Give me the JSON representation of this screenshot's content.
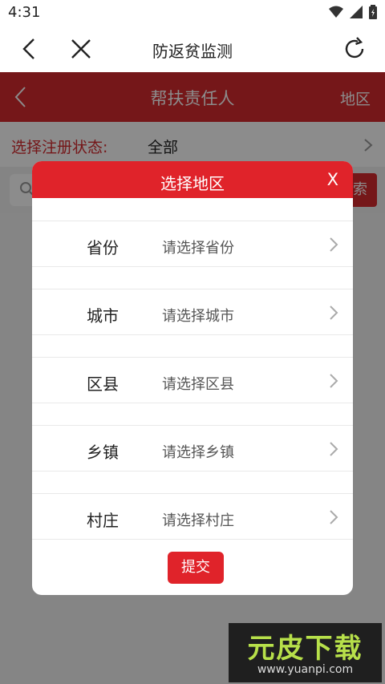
{
  "status_bar": {
    "time": "4:31"
  },
  "nav": {
    "title": "防返贫监测"
  },
  "app_bar": {
    "title": "帮扶责任人",
    "region_label": "地区"
  },
  "filter": {
    "label": "选择注册状态:",
    "value": "全部"
  },
  "search": {
    "button_label": "索"
  },
  "modal": {
    "title": "选择地区",
    "close_label": "X",
    "rows": [
      {
        "label": "省份",
        "placeholder": "请选择省份"
      },
      {
        "label": "城市",
        "placeholder": "请选择城市"
      },
      {
        "label": "区县",
        "placeholder": "请选择区县"
      },
      {
        "label": "乡镇",
        "placeholder": "请选择乡镇"
      },
      {
        "label": "村庄",
        "placeholder": "请选择村庄"
      }
    ],
    "submit_label": "提交"
  },
  "watermark": {
    "brand": "元皮下载",
    "url": "www.yuanpi.com"
  },
  "colors": {
    "brand_red": "#e0232a",
    "appbar_red": "#d52a2f",
    "watermark_green": "#b7e04a"
  }
}
